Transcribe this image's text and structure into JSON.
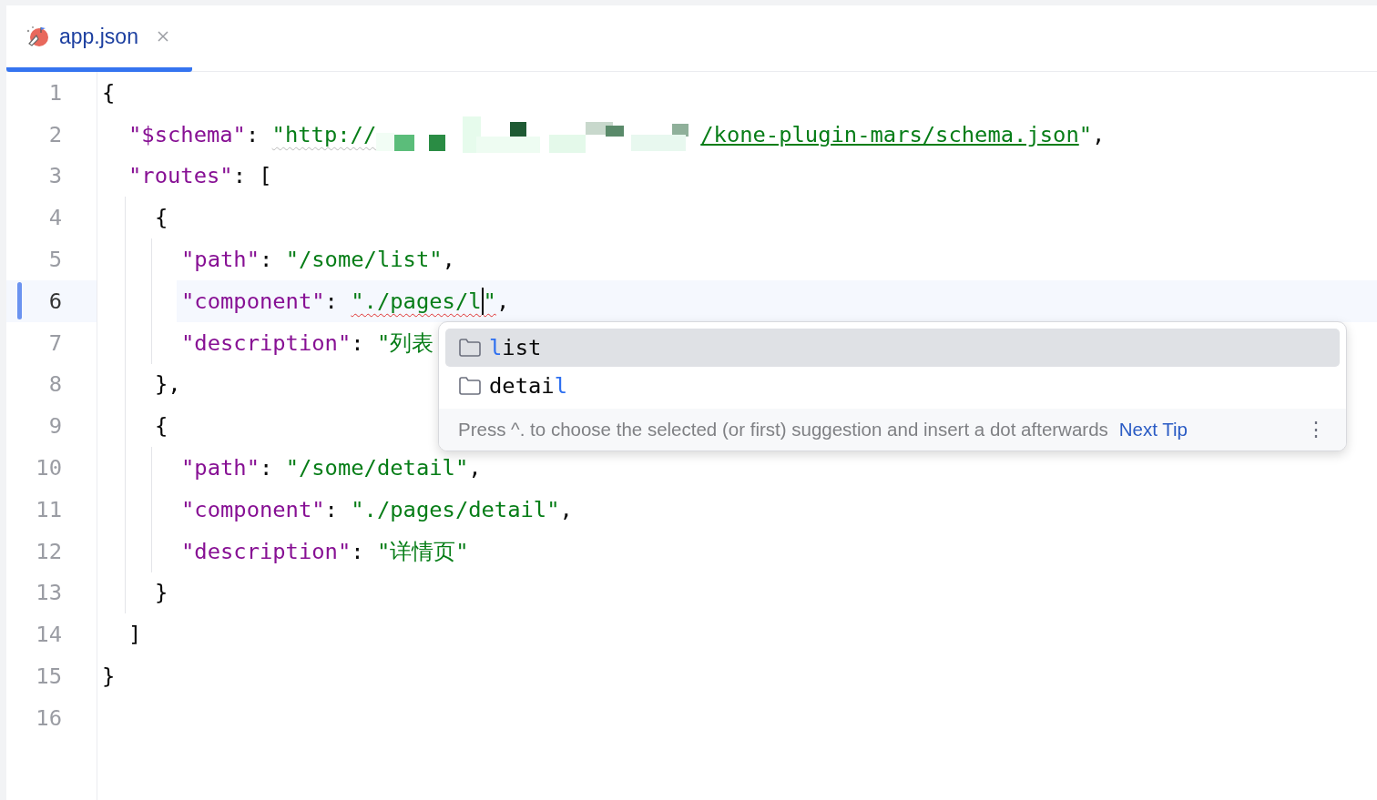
{
  "tabs": [
    {
      "label": "app.json",
      "selected": true
    }
  ],
  "lines": [
    {
      "number": "1",
      "current": false,
      "tokens": [
        {
          "kind": "punct",
          "text": "{"
        }
      ],
      "children": [
        {
          "number": "2",
          "current": false,
          "tokens": [
            {
              "kind": "key",
              "text": "\"$schema\""
            },
            {
              "kind": "punct",
              "text": ": "
            },
            {
              "kind": "string",
              "text": "\"http://",
              "typo": true
            },
            {
              "kind": "redacted"
            },
            {
              "kind": "link",
              "text": "/kone-plugin-mars/schema.json"
            },
            {
              "kind": "string",
              "text": "\""
            },
            {
              "kind": "punct",
              "text": ","
            }
          ]
        },
        {
          "number": "3",
          "current": false,
          "tokens": [
            {
              "kind": "key",
              "text": "\"routes\""
            },
            {
              "kind": "punct",
              "text": ": ["
            }
          ],
          "children": [
            {
              "number": "4",
              "current": false,
              "tokens": [
                {
                  "kind": "punct",
                  "text": "{"
                }
              ],
              "children": [
                {
                  "number": "5",
                  "current": false,
                  "tokens": [
                    {
                      "kind": "key",
                      "text": "\"path\""
                    },
                    {
                      "kind": "punct",
                      "text": ": "
                    },
                    {
                      "kind": "string",
                      "text": "\"/some/list\""
                    },
                    {
                      "kind": "punct",
                      "text": ","
                    }
                  ]
                },
                {
                  "number": "6",
                  "current": true,
                  "tokens": [
                    {
                      "kind": "key",
                      "text": "\"component\""
                    },
                    {
                      "kind": "punct",
                      "text": ": "
                    },
                    {
                      "kind": "string",
                      "text": "\"./pages/l",
                      "error": true
                    },
                    {
                      "kind": "caret"
                    },
                    {
                      "kind": "string",
                      "text": "\"",
                      "error": true
                    },
                    {
                      "kind": "punct",
                      "text": ","
                    }
                  ]
                },
                {
                  "number": "7",
                  "current": false,
                  "tokens": [
                    {
                      "kind": "key",
                      "text": "\"description\""
                    },
                    {
                      "kind": "punct",
                      "text": ": "
                    },
                    {
                      "kind": "string",
                      "text": "\"列表"
                    }
                  ]
                }
              ]
            },
            {
              "number": "8",
              "current": false,
              "tokens": [
                {
                  "kind": "punct",
                  "text": "},"
                }
              ]
            },
            {
              "number": "9",
              "current": false,
              "tokens": [
                {
                  "kind": "punct",
                  "text": "{"
                }
              ],
              "children": [
                {
                  "number": "10",
                  "current": false,
                  "tokens": [
                    {
                      "kind": "key",
                      "text": "\"path\""
                    },
                    {
                      "kind": "punct",
                      "text": ": "
                    },
                    {
                      "kind": "string",
                      "text": "\"/some/detail\""
                    },
                    {
                      "kind": "punct",
                      "text": ","
                    }
                  ]
                },
                {
                  "number": "11",
                  "current": false,
                  "tokens": [
                    {
                      "kind": "key",
                      "text": "\"component\""
                    },
                    {
                      "kind": "punct",
                      "text": ": "
                    },
                    {
                      "kind": "string",
                      "text": "\"./pages/detail\""
                    },
                    {
                      "kind": "punct",
                      "text": ","
                    }
                  ]
                },
                {
                  "number": "12",
                  "current": false,
                  "tokens": [
                    {
                      "kind": "key",
                      "text": "\"description\""
                    },
                    {
                      "kind": "punct",
                      "text": ": "
                    },
                    {
                      "kind": "string",
                      "text": "\"详情页\""
                    }
                  ]
                }
              ]
            },
            {
              "number": "13",
              "current": false,
              "tokens": [
                {
                  "kind": "punct",
                  "text": "}"
                }
              ]
            }
          ]
        },
        {
          "number": "14",
          "current": false,
          "tokens": [
            {
              "kind": "punct",
              "text": "]"
            }
          ]
        }
      ]
    },
    {
      "number": "15",
      "current": false,
      "tokens": [
        {
          "kind": "punct",
          "text": "}"
        }
      ]
    },
    {
      "number": "16",
      "current": false
    }
  ],
  "completion": {
    "items": [
      {
        "selected": true,
        "parts": [
          {
            "text": "l",
            "match": true
          },
          {
            "text": "ist",
            "match": false
          }
        ]
      },
      {
        "selected": false,
        "parts": [
          {
            "text": "detai",
            "match": false
          },
          {
            "text": "l",
            "match": true
          }
        ]
      }
    ],
    "tip": "Press ^. to choose the selected (or first) suggestion and insert a dot afterwards",
    "next_tip": "Next Tip",
    "more": "⋮"
  }
}
